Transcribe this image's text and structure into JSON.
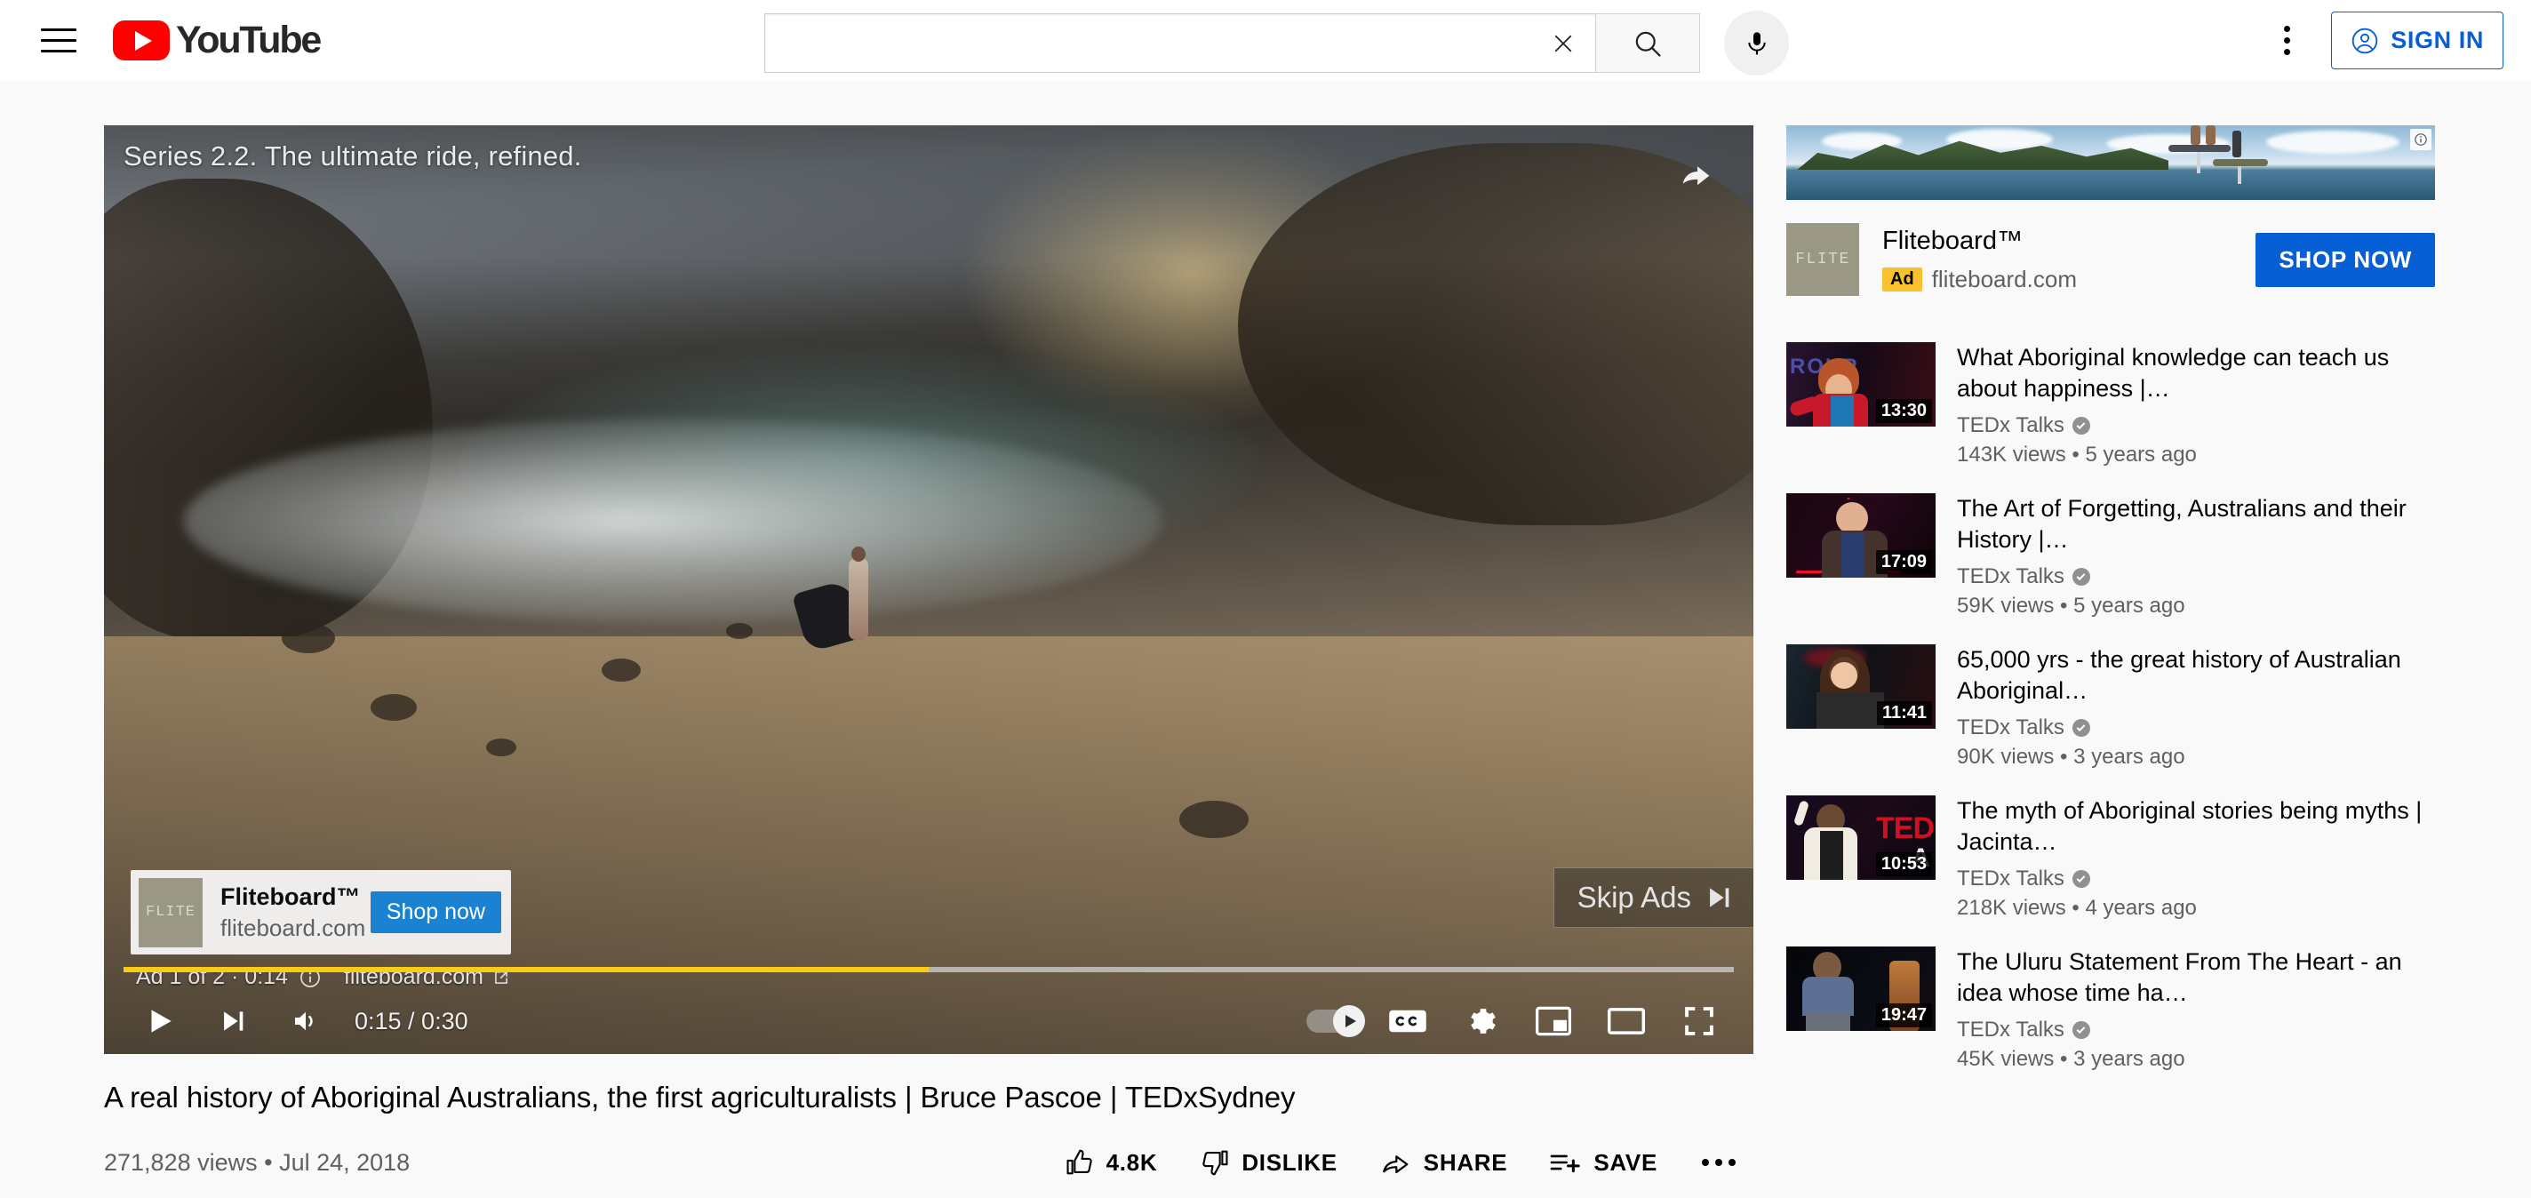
{
  "header": {
    "menu_icon": "hamburger-icon",
    "logo_text": "YouTube",
    "search": {
      "value": "",
      "placeholder": "",
      "clear_icon": "close-icon",
      "submit_icon": "search-icon"
    },
    "mic_icon": "microphone-icon",
    "kebab_icon": "more-vertical-icon",
    "signin_label": "SIGN IN",
    "signin_icon": "account-circle-icon"
  },
  "player": {
    "ad_video_title": "Series 2.2. The ultimate ride, refined.",
    "share_icon": "share-icon",
    "ad_card": {
      "advertiser": "Fliteboard™",
      "url": "fliteboard.com",
      "cta": "Shop now",
      "logo_text": "FLITE"
    },
    "ad_info": {
      "counter": "Ad 1 of 2 · 0:14",
      "info_icon": "info-circle-icon",
      "domain": "fliteboard.com",
      "external_icon": "open-in-new-icon"
    },
    "skip_label": "Skip Ads",
    "skip_icon": "skip-next-icon",
    "progress_percent": 50,
    "progress_color": "#facc14",
    "controls": {
      "play_icon": "play-icon",
      "next_icon": "next-track-icon",
      "volume_icon": "volume-high-icon",
      "time": "0:15 / 0:30",
      "autoplay_icon": "autoplay-toggle-icon",
      "captions_label": "CC",
      "settings_icon": "gear-icon",
      "miniplayer_icon": "miniplayer-icon",
      "theater_icon": "theater-mode-icon",
      "fullscreen_icon": "fullscreen-icon"
    }
  },
  "video": {
    "title": "A real history of Aboriginal Australians, the first agriculturalists | Bruce Pascoe | TEDxSydney",
    "views": "271,828 views",
    "separator": "•",
    "date": "Jul 24, 2018",
    "meta_line": "271,828 views • Jul 24, 2018",
    "actions": [
      {
        "name": "like",
        "label": "4.8K",
        "icon": "thumb-up-icon"
      },
      {
        "name": "dislike",
        "label": "DISLIKE",
        "icon": "thumb-down-icon"
      },
      {
        "name": "share",
        "label": "SHARE",
        "icon": "share-arrow-icon"
      },
      {
        "name": "save",
        "label": "SAVE",
        "icon": "playlist-add-icon"
      }
    ],
    "more_icon": "more-horizontal-icon"
  },
  "sidebar_ad": {
    "advertiser": "Fliteboard™",
    "badge": "Ad",
    "domain": "fliteboard.com",
    "cta": "SHOP NOW",
    "logo_text": "FLITE",
    "info_icon": "info-circle-icon"
  },
  "related": [
    {
      "title": "What Aboriginal knowledge can teach us about happiness |…",
      "channel": "TEDx Talks",
      "verified_icon": "verified-badge-icon",
      "views": "143K views",
      "age": "5 years ago",
      "meta": "143K views • 5 years ago",
      "duration": "13:30"
    },
    {
      "title": "The Art of Forgetting, Australians and their History |…",
      "channel": "TEDx Talks",
      "verified_icon": "verified-badge-icon",
      "views": "59K views",
      "age": "5 years ago",
      "meta": "59K views • 5 years ago",
      "duration": "17:09"
    },
    {
      "title": "65,000 yrs - the great history of Australian Aboriginal…",
      "channel": "TEDx Talks",
      "verified_icon": "verified-badge-icon",
      "views": "90K views",
      "age": "3 years ago",
      "meta": "90K views • 3 years ago",
      "duration": "11:41"
    },
    {
      "title": "The myth of Aboriginal stories being myths | Jacinta…",
      "channel": "TEDx Talks",
      "verified_icon": "verified-badge-icon",
      "views": "218K views",
      "age": "4 years ago",
      "meta": "218K views • 4 years ago",
      "duration": "10:53"
    },
    {
      "title": "The Uluru Statement From The Heart - an idea whose time ha…",
      "channel": "TEDx Talks",
      "verified_icon": "verified-badge-icon",
      "views": "45K views",
      "age": "3 years ago",
      "meta": "45K views • 3 years ago",
      "duration": "19:47"
    }
  ],
  "colors": {
    "brand_red": "#ff0000",
    "link_blue": "#065fd4",
    "ad_yellow": "#facc14",
    "ad_badge_yellow": "#fbc02d",
    "page_bg": "#f9f9f9"
  }
}
